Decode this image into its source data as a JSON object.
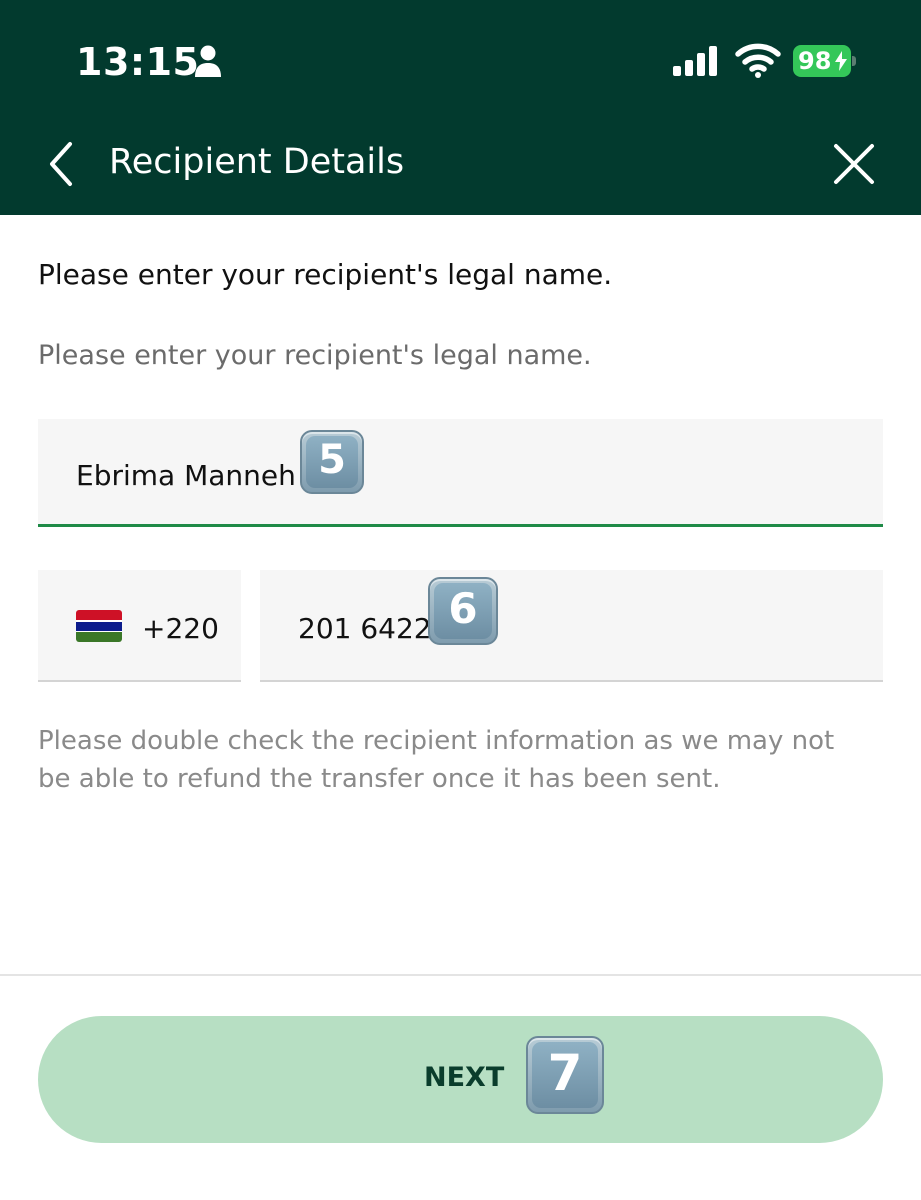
{
  "status_bar": {
    "time": "13:15",
    "battery": "98"
  },
  "nav": {
    "title": "Recipient Details"
  },
  "instruction": "Please enter your recipient's legal name.",
  "name_field": {
    "label": "Please enter your recipient's legal name.",
    "value": "Ebrima Manneh",
    "annotation": "5"
  },
  "phone": {
    "country_code": "+220",
    "number": "201 6422",
    "annotation": "6",
    "flag": "gambia-flag-icon"
  },
  "disclaimer": "Please double check the recipient information as we may not be able to refund the transfer once it has been sent.",
  "next_button": {
    "label": "NEXT",
    "annotation": "7"
  },
  "colors": {
    "header_bg": "#023a2e",
    "focus_underline": "#1f8a47",
    "button_bg": "#b7dfc3",
    "battery": "#34c759"
  }
}
